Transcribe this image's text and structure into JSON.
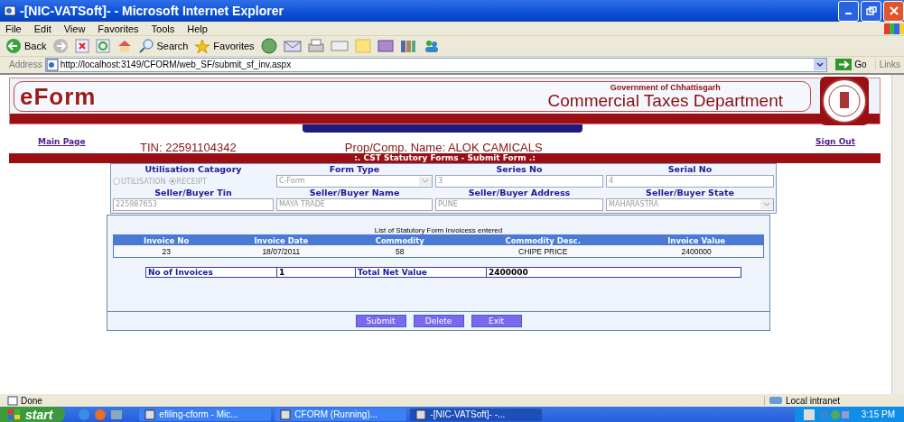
{
  "window": {
    "title": "-[NIC-VATSoft]- - Microsoft Internet Explorer"
  },
  "menu": [
    "File",
    "Edit",
    "View",
    "Favorites",
    "Tools",
    "Help"
  ],
  "toolbar": {
    "back": "Back",
    "search": "Search",
    "favorites": "Favorites"
  },
  "address": {
    "label": "Address",
    "url": "http://localhost:3149/CFORM/web_SF/submit_sf_inv.aspx",
    "go": "Go",
    "links": "Links"
  },
  "banner": {
    "logo": "eForm",
    "government": "Government of Chhattisgarh",
    "department": "Commercial Taxes Department"
  },
  "links": {
    "main_page": "Main Page",
    "sign_out": "Sign Out"
  },
  "tin": "TIN: 22591104342",
  "prop_name": "Prop/Comp. Name: ALOK CAMICALS",
  "section_title": ":. CST Statutory Forms - Submit Form .:",
  "form": {
    "row1_labels": [
      "Utilisation Catagory",
      "Form Type",
      "Series No",
      "Serial No"
    ],
    "radios": [
      {
        "label": "UTILISATION",
        "selected": false
      },
      {
        "label": "RECEIPT",
        "selected": true
      }
    ],
    "form_type": "C-Form",
    "series_no": "3",
    "serial_no": "4",
    "row2_labels": [
      "Seller/Buyer Tin",
      "Seller/Buyer  Name",
      "Seller/Buyer Address",
      "Seller/Buyer State"
    ],
    "tin": "225987653",
    "name": "MAYA TRADE",
    "address": "PUNE",
    "state": "MAHARASTRA"
  },
  "invoices": {
    "caption": "List of Statutory Form Invoicess entered",
    "columns": [
      "Invoice No",
      "Invoice Date",
      "Commodity",
      "Commodity Desc.",
      "Invoice Value"
    ],
    "rows": [
      [
        "23",
        "18/07/2011",
        "58",
        "CHIPE PRICE",
        "2400000"
      ]
    ]
  },
  "summary": {
    "count_label": "No of Invoices",
    "count": "1",
    "total_label": "Total Net Value",
    "total": "2400000"
  },
  "buttons": [
    "Submit",
    "Delete",
    "Exit"
  ],
  "status_bar": {
    "text": "Done",
    "zone": "Local intranet"
  },
  "taskbar": {
    "start": "start",
    "tasks": [
      {
        "label": "efiling-cform - Mic...",
        "selected": false
      },
      {
        "label": "CFORM (Running)...",
        "selected": false
      },
      {
        "label": "-[NIC-VATSoft]- -...",
        "selected": true
      }
    ],
    "clock": "3:15 PM"
  }
}
